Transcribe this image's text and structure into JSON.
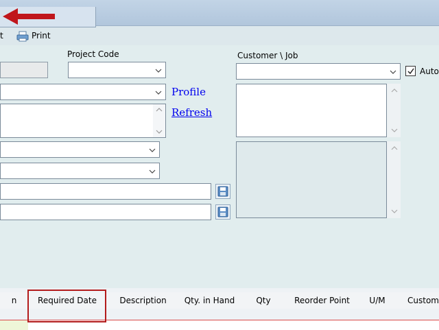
{
  "toolbar": {
    "partial_item": "t",
    "print_label": "Print"
  },
  "fields": {
    "project_code_label": "Project Code",
    "customer_job_label": "Customer \\ Job",
    "auto_label": "Auto",
    "auto_checked": true
  },
  "links": {
    "profile": "Profile",
    "refresh": "Refresh"
  },
  "grid": {
    "headers": [
      "n",
      "Required Date",
      "Description",
      "Qty. in Hand",
      "Qty",
      "Reorder Point",
      "U/M",
      "Custom"
    ]
  },
  "colors": {
    "arrow": "#c0161c",
    "highlight_box": "#b31b1b",
    "link": "#0000ee",
    "form_bg": "#e1edee"
  }
}
